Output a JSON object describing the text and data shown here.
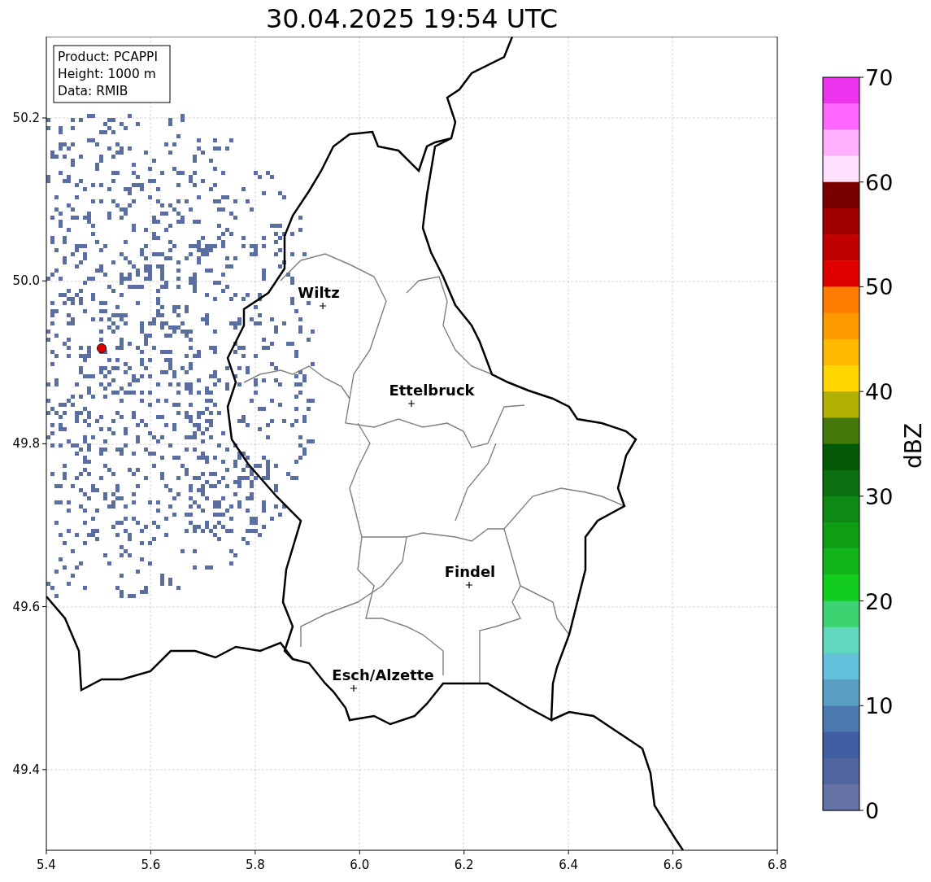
{
  "title": "30.04.2025 19:54 UTC",
  "info_box": [
    "Product: PCAPPI",
    "Height: 1000 m",
    "Data: RMIB"
  ],
  "cities": [
    {
      "name": "Wiltz"
    },
    {
      "name": "Ettelbruck"
    },
    {
      "name": "Findel"
    },
    {
      "name": "Esch/Alzette"
    }
  ],
  "x_ticks": [
    "5.4",
    "5.6",
    "5.8",
    "6.0",
    "6.2",
    "6.4",
    "6.6",
    "6.8"
  ],
  "y_ticks": [
    "50.2",
    "50.0",
    "49.8",
    "49.6",
    "49.4"
  ],
  "colorbar": {
    "label": "dBZ",
    "ticks": [
      "70",
      "60",
      "50",
      "40",
      "30",
      "20",
      "10",
      "0"
    ],
    "bands": [
      {
        "color": "#ee33ee"
      },
      {
        "color": "#ff66ff"
      },
      {
        "color": "#ffb0ff"
      },
      {
        "color": "#ffe0ff"
      },
      {
        "color": "#7a0000"
      },
      {
        "color": "#a00000"
      },
      {
        "color": "#c00000"
      },
      {
        "color": "#e00000"
      },
      {
        "color": "#ff7c00"
      },
      {
        "color": "#ff9a00"
      },
      {
        "color": "#ffb800"
      },
      {
        "color": "#ffd700"
      },
      {
        "color": "#b0b000"
      },
      {
        "color": "#457a0a"
      },
      {
        "color": "#055a08"
      },
      {
        "color": "#0a7010"
      },
      {
        "color": "#0e8a14"
      },
      {
        "color": "#0e9e14"
      },
      {
        "color": "#10b418"
      },
      {
        "color": "#12cc1e"
      },
      {
        "color": "#3cd470"
      },
      {
        "color": "#60d8c0"
      },
      {
        "color": "#62c2dc"
      },
      {
        "color": "#5a9ec6"
      },
      {
        "color": "#4a7ab0"
      },
      {
        "color": "#425ea3"
      },
      {
        "color": "#5065a0"
      },
      {
        "color": "#6673a6"
      }
    ]
  }
}
